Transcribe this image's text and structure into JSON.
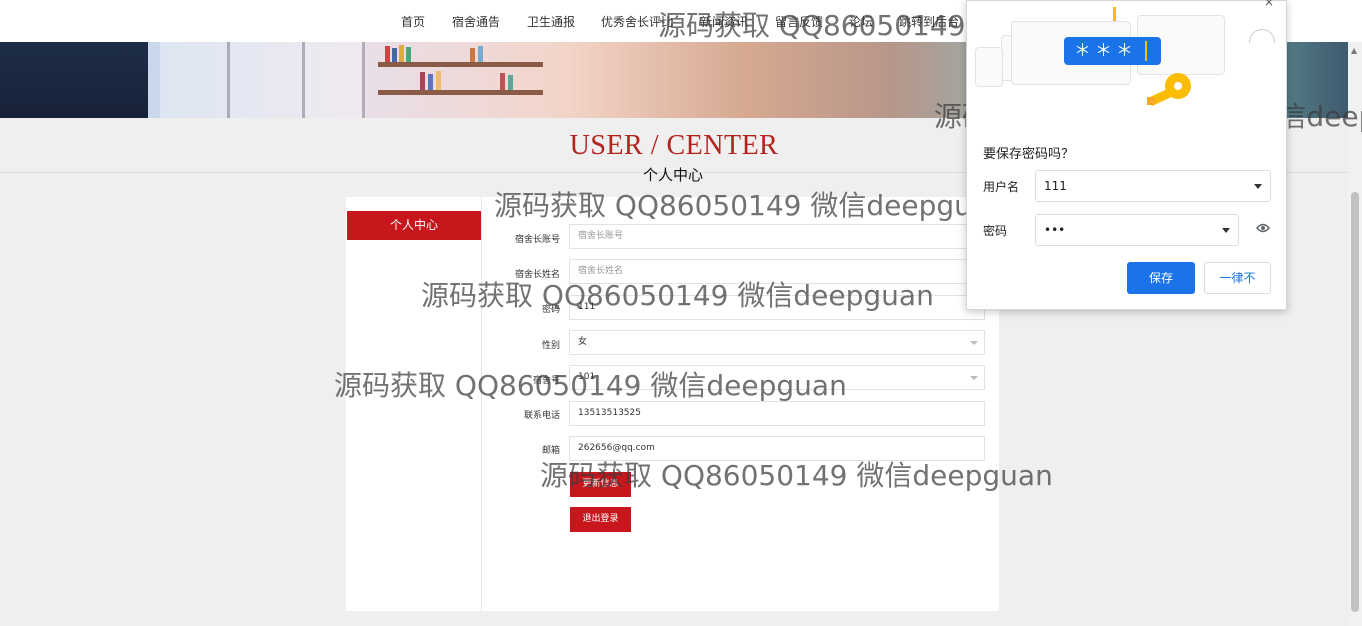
{
  "nav": {
    "items": [
      "首页",
      "宿舍通告",
      "卫生通报",
      "优秀舍长评比",
      "新闻资讯",
      "留言反馈",
      "论坛",
      "跳转到后台"
    ]
  },
  "header": {
    "title_en": "USER / CENTER",
    "title_cn": "个人中心"
  },
  "sidebar": {
    "active_item": "个人中心"
  },
  "form": {
    "account": {
      "label": "宿舍长账号",
      "placeholder": "宿舍长账号"
    },
    "name": {
      "label": "宿舍长姓名",
      "placeholder": "宿舍长姓名"
    },
    "password": {
      "label": "密码",
      "value": "111"
    },
    "gender": {
      "label": "性别",
      "value": "女"
    },
    "dorm": {
      "label": "宿舍号",
      "value": "101"
    },
    "phone": {
      "label": "联系电话",
      "value": "13513513525"
    },
    "email": {
      "label": "邮箱",
      "value": "262656@qq.com"
    },
    "update_label": "更新信息",
    "logout_label": "退出登录"
  },
  "password_popup": {
    "title": "要保存密码吗？",
    "username_label": "用户名",
    "username_value": "111",
    "password_label": "密码",
    "password_value": "•••",
    "save_label": "保存",
    "never_label": "一律不",
    "illustration_pill": "＊＊＊",
    "close": "×"
  },
  "watermark": {
    "text": "源码获取 QQ86050149 微信deepguan"
  },
  "colors": {
    "brand_red": "#c8161d",
    "title_red": "#b3221c",
    "chrome_blue": "#1a73e8",
    "key_yellow": "#fbbc04"
  },
  "icons": {
    "eye": "eye-icon",
    "dropdown": "chevron-down-icon",
    "key": "key-icon"
  }
}
